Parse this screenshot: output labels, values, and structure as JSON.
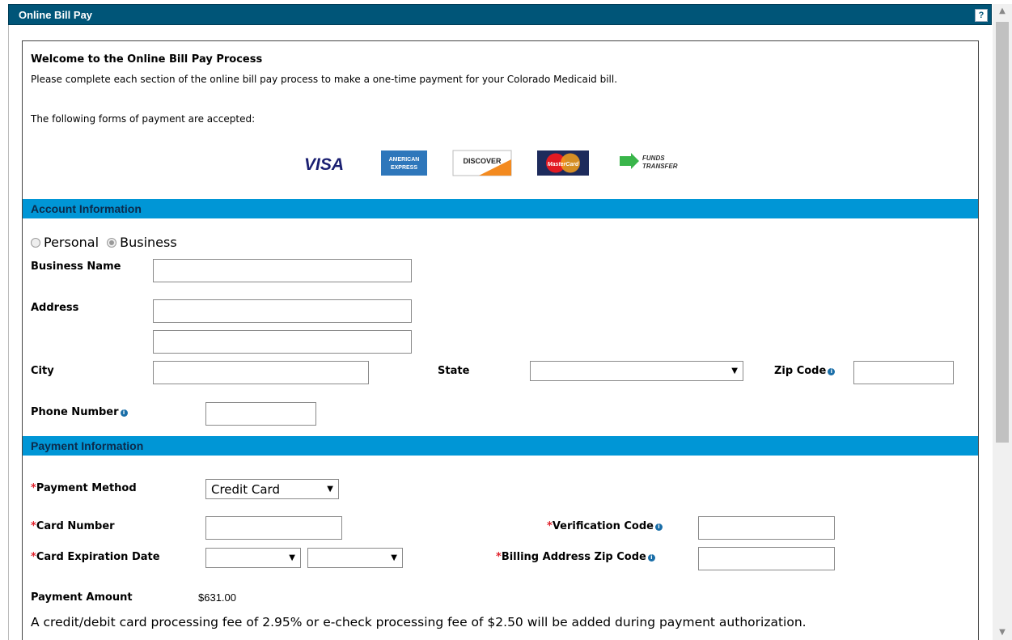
{
  "window": {
    "title": "Online Bill Pay",
    "help_label": "?"
  },
  "intro": {
    "heading": "Welcome to the Online Bill Pay Process",
    "description": "Please complete each section of the online bill pay process to make a one-time payment for your Colorado Medicaid bill.",
    "forms_text": "The following forms of payment are accepted:"
  },
  "payment_logos": {
    "visa": "VISA",
    "amex_top": "AMERICAN",
    "amex_bottom": "EXPRESS",
    "discover": "DISCOVER",
    "mastercard": "MasterCard",
    "funds_top": "FUNDS",
    "funds_bottom": "TRANSFER"
  },
  "account": {
    "section_title": "Account Information",
    "radio_personal": "Personal",
    "radio_business": "Business",
    "selected": "Business",
    "business_name_label": "Business Name",
    "address_label": "Address",
    "city_label": "City",
    "state_label": "State",
    "state_value": "",
    "zip_label": "Zip Code",
    "phone_label": "Phone Number"
  },
  "payment": {
    "section_title": "Payment Information",
    "required_mark": "*",
    "method_label": "Payment Method",
    "method_value": "Credit Card",
    "card_number_label": "Card Number",
    "verification_label": "Verification Code",
    "expiration_label": "Card Expiration Date",
    "exp_month_value": "",
    "exp_year_value": "",
    "billing_zip_label": "Billing Address Zip Code",
    "amount_label": "Payment Amount",
    "amount_value": "$631.00",
    "fee_note": "A credit/debit card processing fee of 2.95% or e-check processing fee of $2.50 will be added during payment authorization."
  },
  "colors": {
    "titlebar": "#005578",
    "section": "#0096d6",
    "required": "#e0212b"
  }
}
